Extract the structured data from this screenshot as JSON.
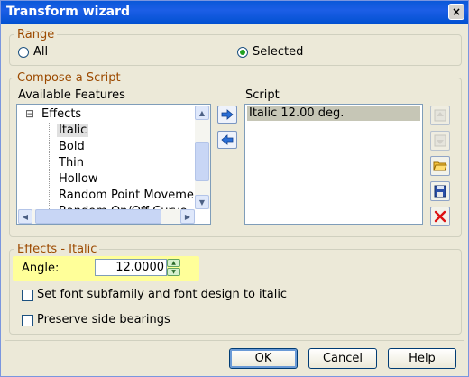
{
  "window": {
    "title": "Transform wizard",
    "close_glyph": "×"
  },
  "range": {
    "legend": "Range",
    "all_label": "All",
    "selected_label": "Selected",
    "selected": "Selected"
  },
  "compose": {
    "legend": "Compose a Script",
    "available_label": "Available Features",
    "script_label": "Script",
    "tree": {
      "root_expander": "⊟",
      "root": "Effects",
      "items": [
        "Italic",
        "Bold",
        "Thin",
        "Hollow",
        "Random Point Moveme",
        "Random On/Off Curve"
      ],
      "selected_item": "Italic"
    },
    "script_items": [
      "Italic 12.00 deg."
    ]
  },
  "effects": {
    "legend": "Effects - Italic",
    "angle_label": "Angle:",
    "angle_value": "12.0000",
    "option1": "Set font subfamily and font design to italic",
    "option2": "Preserve side bearings"
  },
  "buttons": {
    "ok": "OK",
    "cancel": "Cancel",
    "help": "Help"
  },
  "colors": {
    "title_bar": "#0a58d8",
    "legend_text": "#9c4a00",
    "highlight": "#ffff99",
    "dialog_bg": "#ece9d8"
  }
}
